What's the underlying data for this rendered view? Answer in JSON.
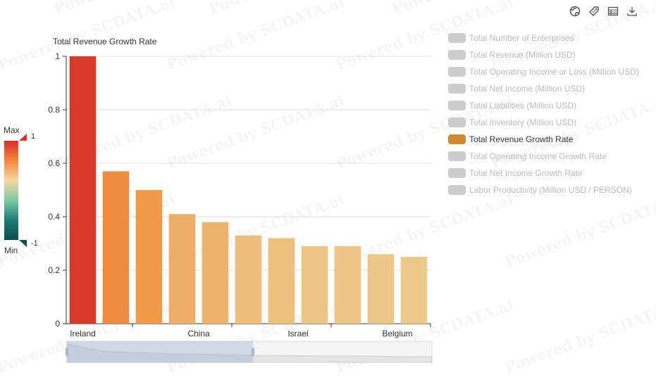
{
  "toolbar": {
    "icons": [
      "globe-icon",
      "tag-icon",
      "table-icon",
      "download-icon"
    ]
  },
  "legend": {
    "items": [
      {
        "label": "Total Number of Enterprises",
        "active": false
      },
      {
        "label": "Total Revenue (Million USD)",
        "active": false
      },
      {
        "label": "Total Operating Income or Loss (Million USD)",
        "active": false
      },
      {
        "label": "Total Net Income (Million USD)",
        "active": false
      },
      {
        "label": "Total Liabilities (Million USD)",
        "active": false
      },
      {
        "label": "Total Inventory (Million USD)",
        "active": false
      },
      {
        "label": "Total Revenue Growth Rate",
        "active": true
      },
      {
        "label": "Total Operating Income Growth Rate",
        "active": false
      },
      {
        "label": "Total Net Income Growth Rate",
        "active": false
      },
      {
        "label": "Labor Productivity (Million USD / PERSON)",
        "active": false
      }
    ],
    "active_color": "#cf8a2e",
    "inactive_color": "#cccccc",
    "active_text_color": "#333333",
    "inactive_text_color": "#bbbbbb"
  },
  "visual_map": {
    "max_label": "Max",
    "min_label": "Min",
    "max_value": "1",
    "min_value": "-1",
    "colors": [
      "#d73027",
      "#ef8a3c",
      "#f6d7a0",
      "#7ccba2",
      "#1f7a78",
      "#0b4f4f"
    ]
  },
  "watermark": "Powered by SCDATA.ai",
  "chart_data": {
    "type": "bar",
    "title": "Total Revenue Growth Rate",
    "categories": [
      "Ireland",
      "",
      "",
      "",
      "",
      "",
      "",
      "",
      "",
      "",
      ""
    ],
    "x_tick_labels": [
      "Ireland",
      "China",
      "Israel",
      "Belgium"
    ],
    "values": [
      1.0,
      0.57,
      0.5,
      0.41,
      0.38,
      0.33,
      0.32,
      0.29,
      0.29,
      0.26,
      0.25
    ],
    "ylim": [
      0,
      1
    ],
    "yticks": [
      0,
      0.2,
      0.4,
      0.6,
      0.8,
      1
    ],
    "grid": true,
    "bar_colors": [
      "#d73a28",
      "#ef8c40",
      "#f09a4a",
      "#edae68",
      "#edb26c",
      "#eebf7c",
      "#eec07e",
      "#eec484",
      "#eec484",
      "#ecc888",
      "#ecca8a"
    ],
    "data_zoom": {
      "start_fraction": 0,
      "end_fraction": 0.51
    }
  }
}
